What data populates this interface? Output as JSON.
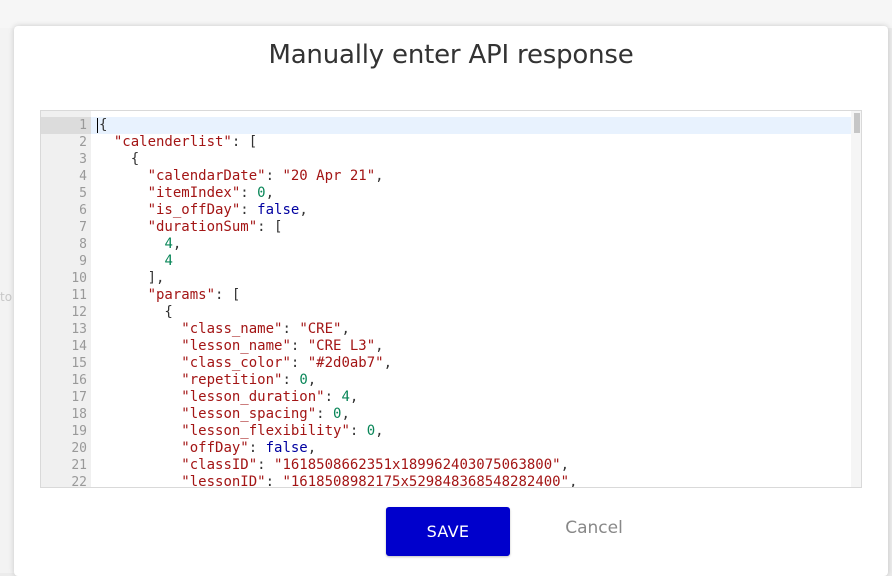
{
  "dialog": {
    "title": "Manually enter API response",
    "save_label": "SAVE",
    "cancel_label": "Cancel"
  },
  "background": {
    "left_text": "to"
  },
  "editor": {
    "active_line": 1,
    "lines": [
      [
        {
          "t": "p",
          "v": "{"
        }
      ],
      [
        {
          "t": "p",
          "v": "  "
        },
        {
          "t": "k",
          "v": "\"calenderlist\""
        },
        {
          "t": "p",
          "v": ": ["
        }
      ],
      [
        {
          "t": "p",
          "v": "    {"
        }
      ],
      [
        {
          "t": "p",
          "v": "      "
        },
        {
          "t": "k",
          "v": "\"calendarDate\""
        },
        {
          "t": "p",
          "v": ": "
        },
        {
          "t": "s",
          "v": "\"20 Apr 21\""
        },
        {
          "t": "p",
          "v": ","
        }
      ],
      [
        {
          "t": "p",
          "v": "      "
        },
        {
          "t": "k",
          "v": "\"itemIndex\""
        },
        {
          "t": "p",
          "v": ": "
        },
        {
          "t": "n",
          "v": "0"
        },
        {
          "t": "p",
          "v": ","
        }
      ],
      [
        {
          "t": "p",
          "v": "      "
        },
        {
          "t": "k",
          "v": "\"is_offDay\""
        },
        {
          "t": "p",
          "v": ": "
        },
        {
          "t": "b",
          "v": "false"
        },
        {
          "t": "p",
          "v": ","
        }
      ],
      [
        {
          "t": "p",
          "v": "      "
        },
        {
          "t": "k",
          "v": "\"durationSum\""
        },
        {
          "t": "p",
          "v": ": ["
        }
      ],
      [
        {
          "t": "p",
          "v": "        "
        },
        {
          "t": "n",
          "v": "4"
        },
        {
          "t": "p",
          "v": ","
        }
      ],
      [
        {
          "t": "p",
          "v": "        "
        },
        {
          "t": "n",
          "v": "4"
        }
      ],
      [
        {
          "t": "p",
          "v": "      ],"
        }
      ],
      [
        {
          "t": "p",
          "v": "      "
        },
        {
          "t": "k",
          "v": "\"params\""
        },
        {
          "t": "p",
          "v": ": ["
        }
      ],
      [
        {
          "t": "p",
          "v": "        {"
        }
      ],
      [
        {
          "t": "p",
          "v": "          "
        },
        {
          "t": "k",
          "v": "\"class_name\""
        },
        {
          "t": "p",
          "v": ": "
        },
        {
          "t": "s",
          "v": "\"CRE\""
        },
        {
          "t": "p",
          "v": ","
        }
      ],
      [
        {
          "t": "p",
          "v": "          "
        },
        {
          "t": "k",
          "v": "\"lesson_name\""
        },
        {
          "t": "p",
          "v": ": "
        },
        {
          "t": "s",
          "v": "\"CRE L3\""
        },
        {
          "t": "p",
          "v": ","
        }
      ],
      [
        {
          "t": "p",
          "v": "          "
        },
        {
          "t": "k",
          "v": "\"class_color\""
        },
        {
          "t": "p",
          "v": ": "
        },
        {
          "t": "s",
          "v": "\"#2d0ab7\""
        },
        {
          "t": "p",
          "v": ","
        }
      ],
      [
        {
          "t": "p",
          "v": "          "
        },
        {
          "t": "k",
          "v": "\"repetition\""
        },
        {
          "t": "p",
          "v": ": "
        },
        {
          "t": "n",
          "v": "0"
        },
        {
          "t": "p",
          "v": ","
        }
      ],
      [
        {
          "t": "p",
          "v": "          "
        },
        {
          "t": "k",
          "v": "\"lesson_duration\""
        },
        {
          "t": "p",
          "v": ": "
        },
        {
          "t": "n",
          "v": "4"
        },
        {
          "t": "p",
          "v": ","
        }
      ],
      [
        {
          "t": "p",
          "v": "          "
        },
        {
          "t": "k",
          "v": "\"lesson_spacing\""
        },
        {
          "t": "p",
          "v": ": "
        },
        {
          "t": "n",
          "v": "0"
        },
        {
          "t": "p",
          "v": ","
        }
      ],
      [
        {
          "t": "p",
          "v": "          "
        },
        {
          "t": "k",
          "v": "\"lesson_flexibility\""
        },
        {
          "t": "p",
          "v": ": "
        },
        {
          "t": "n",
          "v": "0"
        },
        {
          "t": "p",
          "v": ","
        }
      ],
      [
        {
          "t": "p",
          "v": "          "
        },
        {
          "t": "k",
          "v": "\"offDay\""
        },
        {
          "t": "p",
          "v": ": "
        },
        {
          "t": "b",
          "v": "false"
        },
        {
          "t": "p",
          "v": ","
        }
      ],
      [
        {
          "t": "p",
          "v": "          "
        },
        {
          "t": "k",
          "v": "\"classID\""
        },
        {
          "t": "p",
          "v": ": "
        },
        {
          "t": "s",
          "v": "\"1618508662351x189962403075063800\""
        },
        {
          "t": "p",
          "v": ","
        }
      ],
      [
        {
          "t": "p",
          "v": "          "
        },
        {
          "t": "k",
          "v": "\"lessonID\""
        },
        {
          "t": "p",
          "v": ": "
        },
        {
          "t": "s",
          "v": "\"1618508982175x529848368548282400\""
        },
        {
          "t": "p",
          "v": ","
        }
      ]
    ]
  },
  "colors": {
    "save_button": "#0000cc",
    "key_string": "#a31515",
    "number": "#098658",
    "boolean": "#0000a0"
  }
}
